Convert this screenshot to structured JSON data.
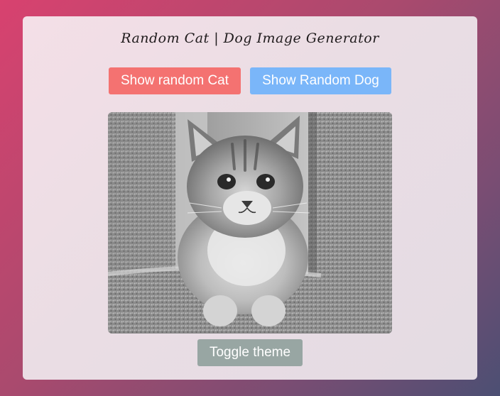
{
  "header": {
    "title": "Random Cat | Dog Image Generator"
  },
  "buttons": {
    "cat_label": "Show random Cat",
    "dog_label": "Show Random Dog",
    "theme_label": "Toggle theme"
  },
  "image": {
    "alt": "Random cat image",
    "subject": "grayscale kitten sitting on a carpeted cat tree"
  },
  "colors": {
    "cat_button": "#f47271",
    "dog_button": "#7ab6f9",
    "theme_button": "#98a6a3"
  }
}
